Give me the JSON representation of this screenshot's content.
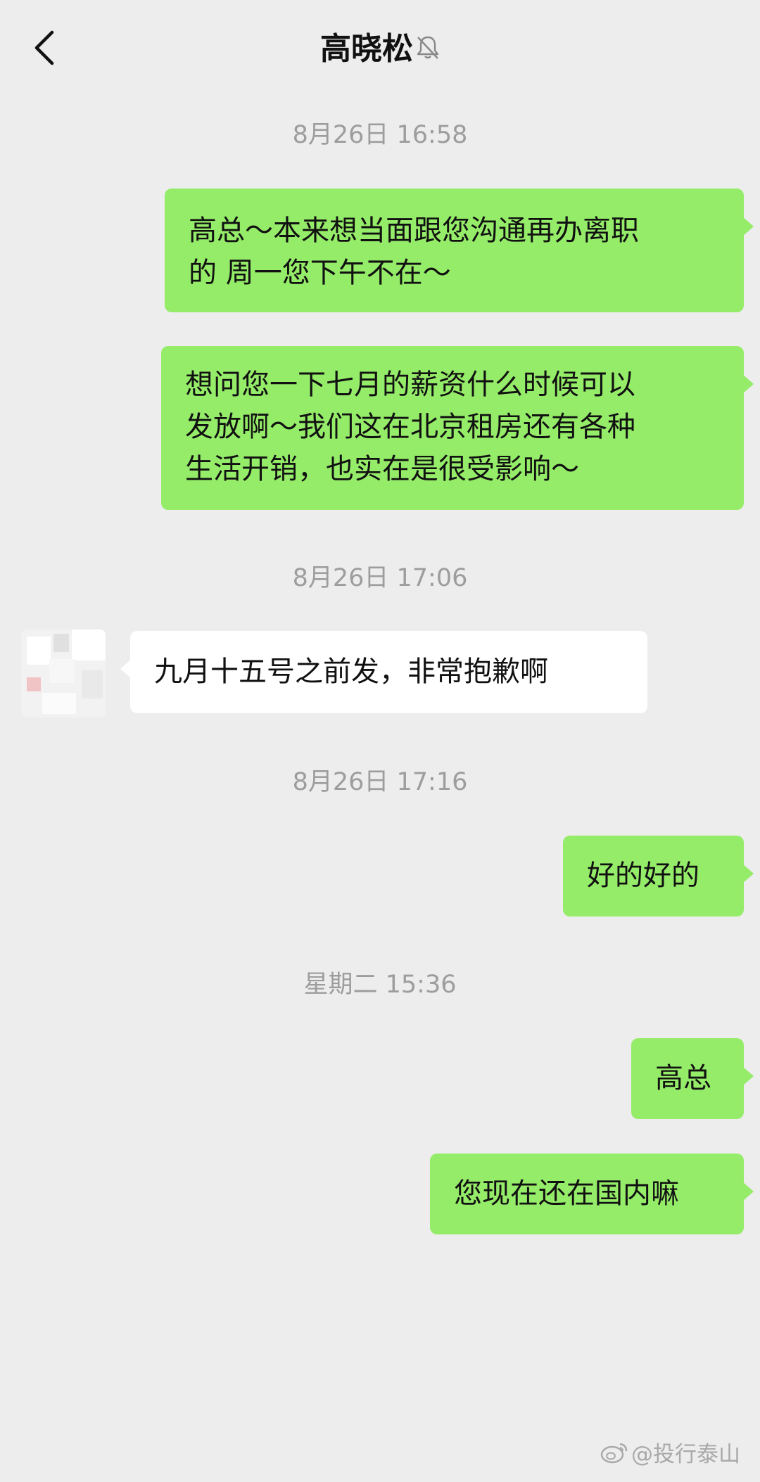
{
  "header": {
    "contact_name": "高晓松",
    "icons": {
      "back": "back-chevron-icon",
      "mute": "muted-bell-icon"
    }
  },
  "messages": [
    {
      "type": "timestamp",
      "text": "8月26日 16:58"
    },
    {
      "type": "sent",
      "lines": [
        "高总～本来想当面跟您沟通再办离职",
        "的 周一您下午不在～"
      ]
    },
    {
      "type": "sent",
      "lines": [
        "想问您一下七月的薪资什么时候可以",
        "发放啊～我们这在北京租房还有各种",
        "生活开销，也实在是很受影响～"
      ]
    },
    {
      "type": "timestamp",
      "text": "8月26日 17:06"
    },
    {
      "type": "received",
      "lines": [
        "九月十五号之前发，非常抱歉啊"
      ],
      "avatar": "pixelated-avatar"
    },
    {
      "type": "timestamp",
      "text": "8月26日 17:16"
    },
    {
      "type": "sent",
      "lines": [
        "好的好的"
      ]
    },
    {
      "type": "timestamp",
      "text": "星期二 15:36"
    },
    {
      "type": "sent",
      "lines": [
        "高总"
      ]
    },
    {
      "type": "sent",
      "lines": [
        "您现在还在国内嘛"
      ]
    }
  ],
  "colors": {
    "background": "#ededed",
    "sent_bubble": "#95ec69",
    "received_bubble": "#ffffff",
    "timestamp_text": "#9d9d9d"
  },
  "watermark": {
    "text": "@投行泰山",
    "icon": "weibo-logo-icon"
  }
}
